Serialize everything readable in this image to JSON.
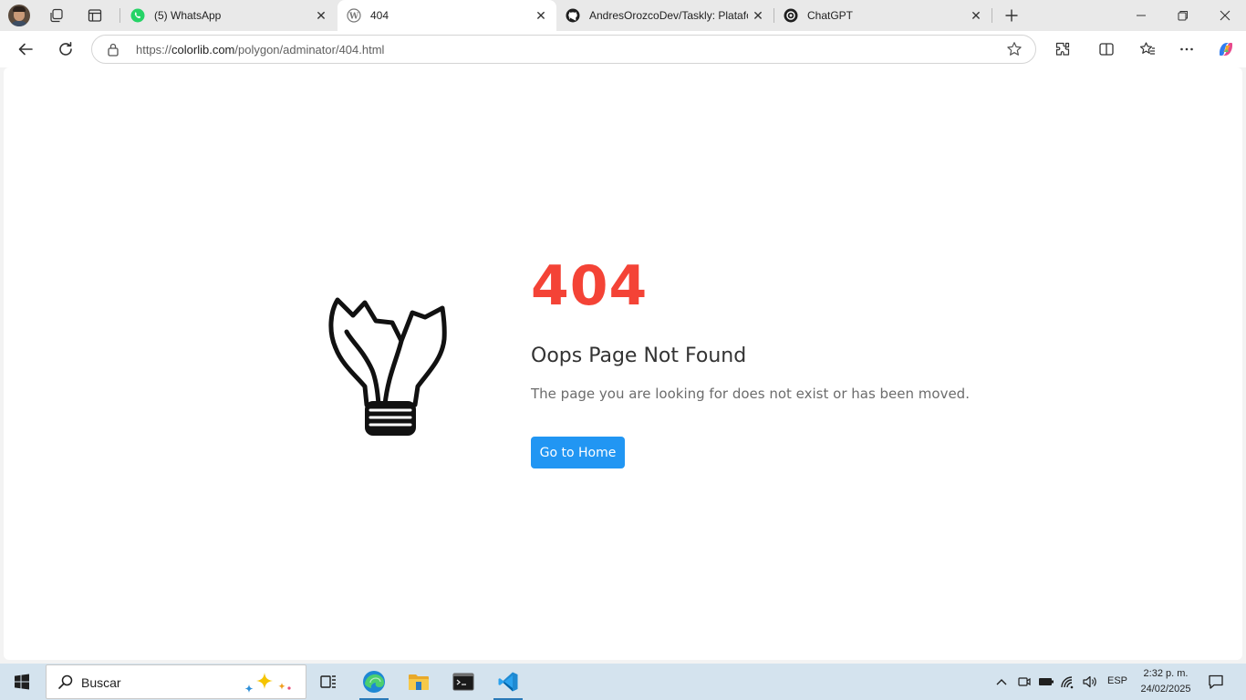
{
  "browser": {
    "tabs": [
      {
        "title": "(5) WhatsApp",
        "favicon": "whatsapp-icon",
        "active": false
      },
      {
        "title": "404",
        "favicon": "wordpress-icon",
        "active": true
      },
      {
        "title": "AndresOrozcoDev/Taskly: Platafor",
        "favicon": "github-icon",
        "active": false
      },
      {
        "title": "ChatGPT",
        "favicon": "chatgpt-icon",
        "active": false
      }
    ],
    "url_prefix": "https://",
    "url_host": "colorlib.com",
    "url_path": "/polygon/adminator/404.html"
  },
  "page": {
    "error_code": "404",
    "title": "Oops Page Not Found",
    "message": "The page you are looking for does not exist or has been moved.",
    "button_label": "Go to Home",
    "accent_color": "#f44336",
    "button_color": "#2196f3",
    "illustration": "broken-lightbulb-icon"
  },
  "taskbar": {
    "search_placeholder": "Buscar",
    "language": "ESP",
    "time": "2:32 p. m.",
    "date": "24/02/2025",
    "pinned": [
      "task-view-icon",
      "edge-icon",
      "file-explorer-icon",
      "terminal-icon",
      "vscode-icon"
    ]
  }
}
